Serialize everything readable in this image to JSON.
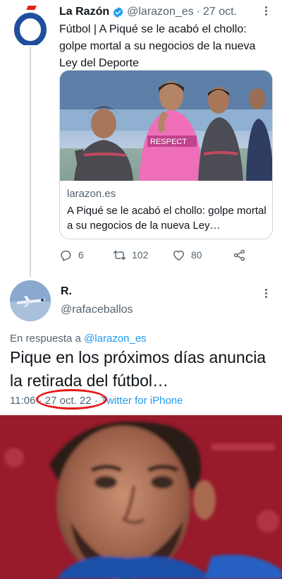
{
  "tweet1": {
    "author_name": "La Razón",
    "handle": "@larazon_es",
    "date": "27 oct.",
    "text": "Fútbol | A Piqué se le acabó el chollo: golpe mortal a su negocios de la nueva Ley del Deporte",
    "card": {
      "domain": "larazon.es",
      "title": "A Piqué se le acabó el chollo: golpe mortal a su negocios de la nueva Ley…",
      "bib_text": "RESPECT"
    },
    "actions": {
      "replies": "6",
      "retweets": "102",
      "likes": "80"
    }
  },
  "tweet2": {
    "author_name": "R.",
    "handle": "@rafaceballos",
    "reply_prefix": "En respuesta a",
    "reply_to": "@larazon_es",
    "text": "Pique en los próximos días anuncia la retirada del fútbol…",
    "time": "11:06",
    "date": "27 oct. 22",
    "source": "Twitter for iPhone"
  },
  "colors": {
    "link": "#1d9bf0",
    "muted": "#536471",
    "highlight_circle": "#e31a1a",
    "logo_blue": "#1f4e9c",
    "logo_red": "#e2231a"
  },
  "icons": [
    "verified-badge-icon",
    "more-icon",
    "reply-icon",
    "retweet-icon",
    "like-icon",
    "share-icon"
  ]
}
